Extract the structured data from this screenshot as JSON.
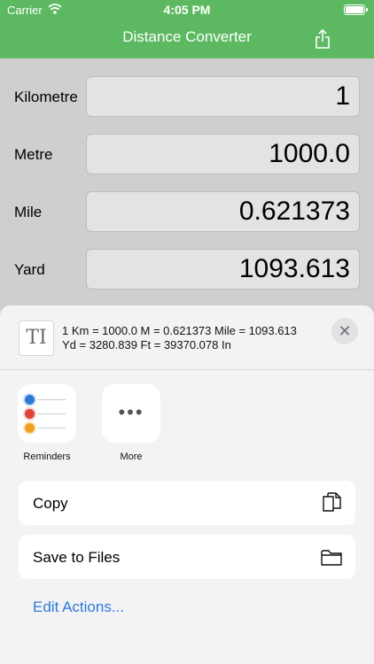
{
  "status_bar": {
    "carrier": "Carrier",
    "time": "4:05 PM"
  },
  "nav": {
    "title": "Distance Converter",
    "share_icon": "share-icon"
  },
  "converter": {
    "rows": [
      {
        "label": "Kilometre",
        "value": "1"
      },
      {
        "label": "Metre",
        "value": "1000.0"
      },
      {
        "label": "Mile",
        "value": "0.621373"
      },
      {
        "label": "Yard",
        "value": "1093.613"
      }
    ]
  },
  "share_sheet": {
    "preview_line1": "1 Km = 1000.0 M = 0.621373 Mile = 1093.613",
    "preview_line2": "Yd = 3280.839 Ft = 39370.078 In",
    "thumb_glyph": "TI",
    "close_glyph": "✕",
    "apps": [
      {
        "name": "Reminders",
        "icon": "reminders-icon"
      },
      {
        "name": "More",
        "icon": "more-icon"
      }
    ],
    "actions": [
      {
        "label": "Copy",
        "icon": "copy-icon"
      },
      {
        "label": "Save to Files",
        "icon": "folder-icon"
      }
    ],
    "edit_actions": "Edit Actions..."
  },
  "colors": {
    "accent": "#5db961",
    "link": "#2d7ad6",
    "reminder_dots": [
      "#2d7ad6",
      "#e0433a",
      "#f0a020"
    ]
  }
}
